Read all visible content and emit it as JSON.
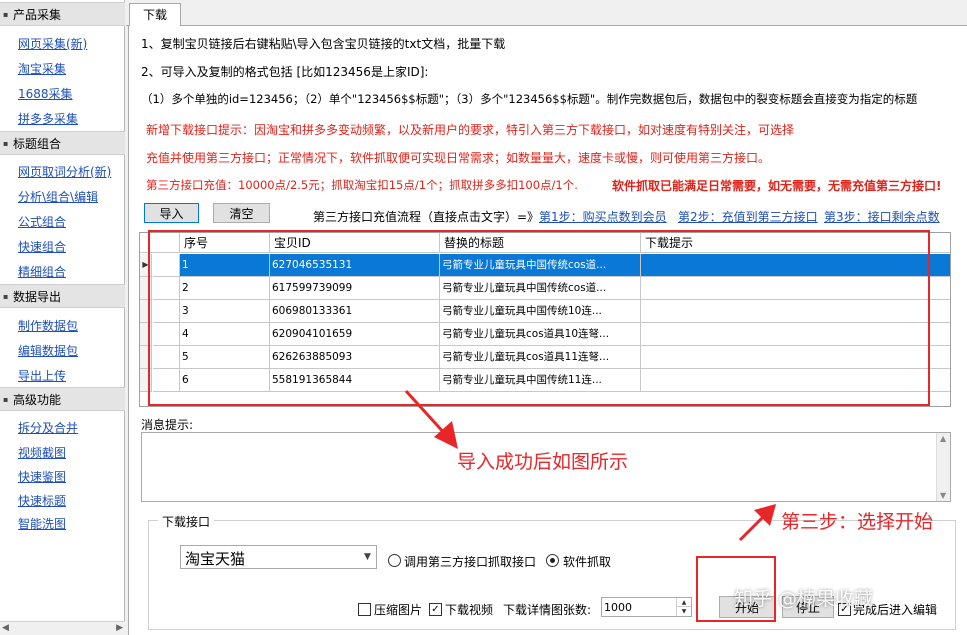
{
  "sidebar": {
    "sections": [
      {
        "title": "产品采集",
        "items": [
          "网页采集(新)",
          "淘宝采集",
          "1688采集",
          "拼多多采集"
        ]
      },
      {
        "title": "标题组合",
        "items": [
          "网页取词分析(新)",
          "分析\\组合\\编辑",
          "公式组合",
          "快速组合",
          "精细组合"
        ]
      },
      {
        "title": "数据导出",
        "items": [
          "制作数据包",
          "编辑数据包",
          "导出上传"
        ]
      },
      {
        "title": "高级功能",
        "items": [
          "拆分及合并",
          "视频截图",
          "快速鉴图",
          "快速标题",
          "智能洗图"
        ]
      }
    ]
  },
  "tab": {
    "label": "下载"
  },
  "instructions": {
    "line1": "1、复制宝贝链接后右键粘贴\\导入包含宝贝链接的txt文档，批量下载",
    "line2": "2、可导入及复制的格式包括   [比如123456是上家ID]:",
    "line3": "（1）多个单独的id=123456；（2）单个\"123456$$标题\"；（3）多个\"123456$$标题\"。制作完数据包后，数据包中的裂变标题会直接变为指定的标题"
  },
  "notice": {
    "line1": "新增下载接口提示：因淘宝和拼多多变动频繁，以及新用户的要求，特引入第三方下载接口，如对速度有特别关注，可选择",
    "line2": "充值并使用第三方接口；正常情况下，软件抓取便可实现日常需求；如数量量大，速度卡或慢，则可使用第三方接口。",
    "recharge": "第三方接口充值：10000点/2.5元；抓取淘宝扣15点/1个；抓取拼多多扣100点/1个.",
    "recharge_bold": "软件抓取已能满足日常需要，如无需要，无需充值第三方接口!"
  },
  "toolbar": {
    "import_label": "导入",
    "clear_label": "清空",
    "flow_text": "第三方接口充值流程（直接点击文字）=》",
    "step1": "第1步：购买点数到会员",
    "step2": "第2步：充值到第三方接口",
    "step3": "第3步：接口剩余点数"
  },
  "table": {
    "columns": [
      "序号",
      "宝贝ID",
      "替换的标题",
      "下载提示"
    ],
    "rows": [
      {
        "index": "1",
        "id": "627046535131",
        "title": "弓箭专业儿童玩具中国传统cos道...",
        "tip": ""
      },
      {
        "index": "2",
        "id": "617599739099",
        "title": "弓箭专业儿童玩具中国传统cos道...",
        "tip": ""
      },
      {
        "index": "3",
        "id": "606980133361",
        "title": "弓箭专业儿童玩具中国传统10连...",
        "tip": ""
      },
      {
        "index": "4",
        "id": "620904101659",
        "title": "弓箭专业儿童玩具cos道具10连弩...",
        "tip": ""
      },
      {
        "index": "5",
        "id": "626263885093",
        "title": "弓箭专业儿童玩具cos道具11连弩...",
        "tip": ""
      },
      {
        "index": "6",
        "id": "558191365844",
        "title": "弓箭专业儿童玩具中国传统11连...",
        "tip": ""
      }
    ],
    "selected_row": 0
  },
  "message": {
    "label": "消息提示:",
    "content": ""
  },
  "download": {
    "group_label": "下载接口",
    "platform_value": "淘宝天猫",
    "radio_third_party": "调用第三方接口抓取接口",
    "radio_software": "软件抓取",
    "software_selected": true,
    "compress_label": "压缩图片",
    "compress_checked": false,
    "video_label": "下载视频",
    "video_checked": true,
    "detail_count_label": "下载详情图张数:",
    "detail_count_value": "1000",
    "start_label": "开始",
    "stop_label": "停止",
    "edit_after_label": "完成后进入编辑",
    "edit_after_checked": true
  },
  "annotations": {
    "import_success": "导入成功后如图所示",
    "step_three": "第三步：选择开始",
    "watermark": "知乎 @楠果收藏"
  },
  "colors": {
    "highlight": "#0a78d7",
    "notice_red": "#e0231b",
    "annotation_red": "#e8262a",
    "link_blue": "#1e4fb8"
  }
}
